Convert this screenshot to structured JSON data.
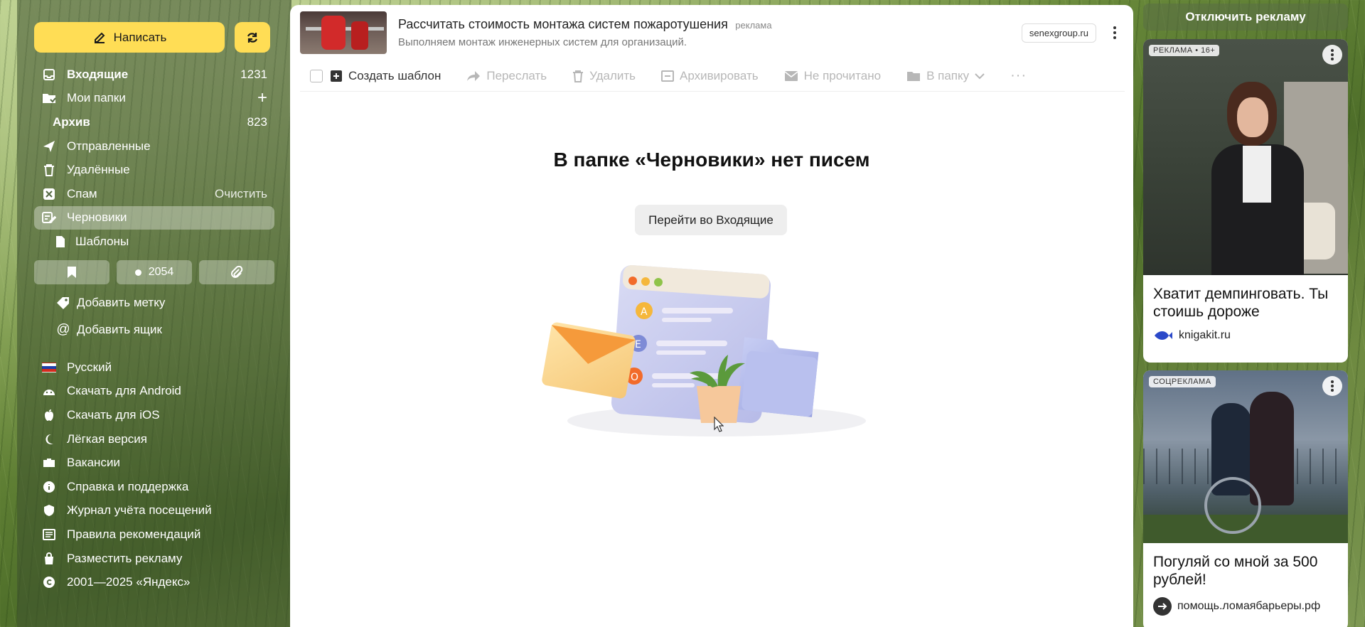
{
  "sidebar": {
    "compose_label": "Написать",
    "folders": [
      {
        "label": "Входящие",
        "count": "1231",
        "icon": "inbox-icon"
      },
      {
        "label": "Мои папки",
        "count": "+",
        "icon": "folder-icon"
      },
      {
        "label": "Архив",
        "count": "823"
      },
      {
        "label": "Отправленные",
        "count": "",
        "icon": "send-icon"
      },
      {
        "label": "Удалённые",
        "count": "",
        "icon": "trash-icon"
      },
      {
        "label": "Спам",
        "count": "Очистить",
        "icon": "spam-icon"
      },
      {
        "label": "Черновики",
        "count": "",
        "icon": "drafts-icon"
      },
      {
        "label": "Шаблоны",
        "count": "",
        "icon": "template-icon"
      }
    ],
    "tools": {
      "unread_count": "2054"
    },
    "add_label": "Добавить метку",
    "add_mailbox": "Добавить ящик",
    "links": [
      {
        "label": "Русский",
        "icon": "russia-flag-icon"
      },
      {
        "label": "Скачать для Android",
        "icon": "android-icon"
      },
      {
        "label": "Скачать для iOS",
        "icon": "apple-icon"
      },
      {
        "label": "Лёгкая версия",
        "icon": "moon-icon"
      },
      {
        "label": "Вакансии",
        "icon": "briefcase-icon"
      },
      {
        "label": "Справка и поддержка",
        "icon": "info-icon"
      },
      {
        "label": "Журнал учёта посещений",
        "icon": "shield-icon"
      },
      {
        "label": "Правила рекомендаций",
        "icon": "list-icon"
      },
      {
        "label": "Разместить рекламу",
        "icon": "bag-icon"
      },
      {
        "label": "2001—2025 «Яндекс»",
        "icon": "copyright-icon"
      }
    ]
  },
  "top_ad": {
    "title": "Рассчитать стоимость монтажа систем пожаротушения",
    "mark": "реклама",
    "description": "Выполняем монтаж инженерных систем для организаций.",
    "domain": "senexgroup.ru"
  },
  "toolbar": {
    "create_template": "Создать шаблон",
    "forward": "Переслать",
    "delete": "Удалить",
    "archive": "Архивировать",
    "unread": "Не прочитано",
    "to_folder": "В папку",
    "more": "···"
  },
  "empty_state": {
    "title": "В папке «Черновики» нет писем",
    "button": "Перейти во Входящие"
  },
  "right_ads": {
    "disable": "Отключить рекламу",
    "ad1": {
      "badge": "РЕКЛАМА • 16+",
      "headline": "Хватит демпинговать. Ты стоишь дороже",
      "site": "knigakit.ru"
    },
    "ad2": {
      "badge": "СОЦРЕКЛАМА",
      "headline": "Погуляй со мной за 500 рублей!",
      "site": "помощь.ломаябарьеры.рф"
    }
  },
  "colors": {
    "accent": "#ffdd55",
    "sidebar_overlay": "rgba(60,80,45,0.55)"
  }
}
